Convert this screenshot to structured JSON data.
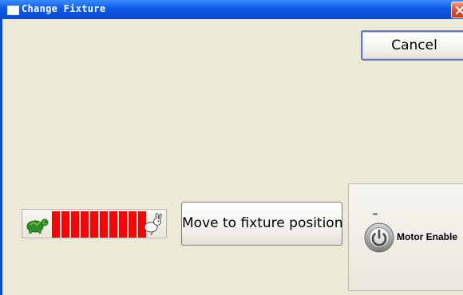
{
  "window": {
    "title": "Change Fixture",
    "close_icon": "close-icon"
  },
  "toolbar": {
    "cancel_label": "Cancel"
  },
  "speed_control": {
    "min_icon": "turtle-icon",
    "max_icon": "rabbit-icon",
    "segments_total": 10,
    "segments_filled": 10,
    "fill_color": "#FF0000"
  },
  "actions": {
    "move_label": "Move to fixture position"
  },
  "motor": {
    "label": "Motor Enable",
    "icon": "power-icon"
  },
  "colors": {
    "titlebar": "#0F5BE6",
    "background": "#ECE9D8",
    "close": "#E04A2A"
  }
}
